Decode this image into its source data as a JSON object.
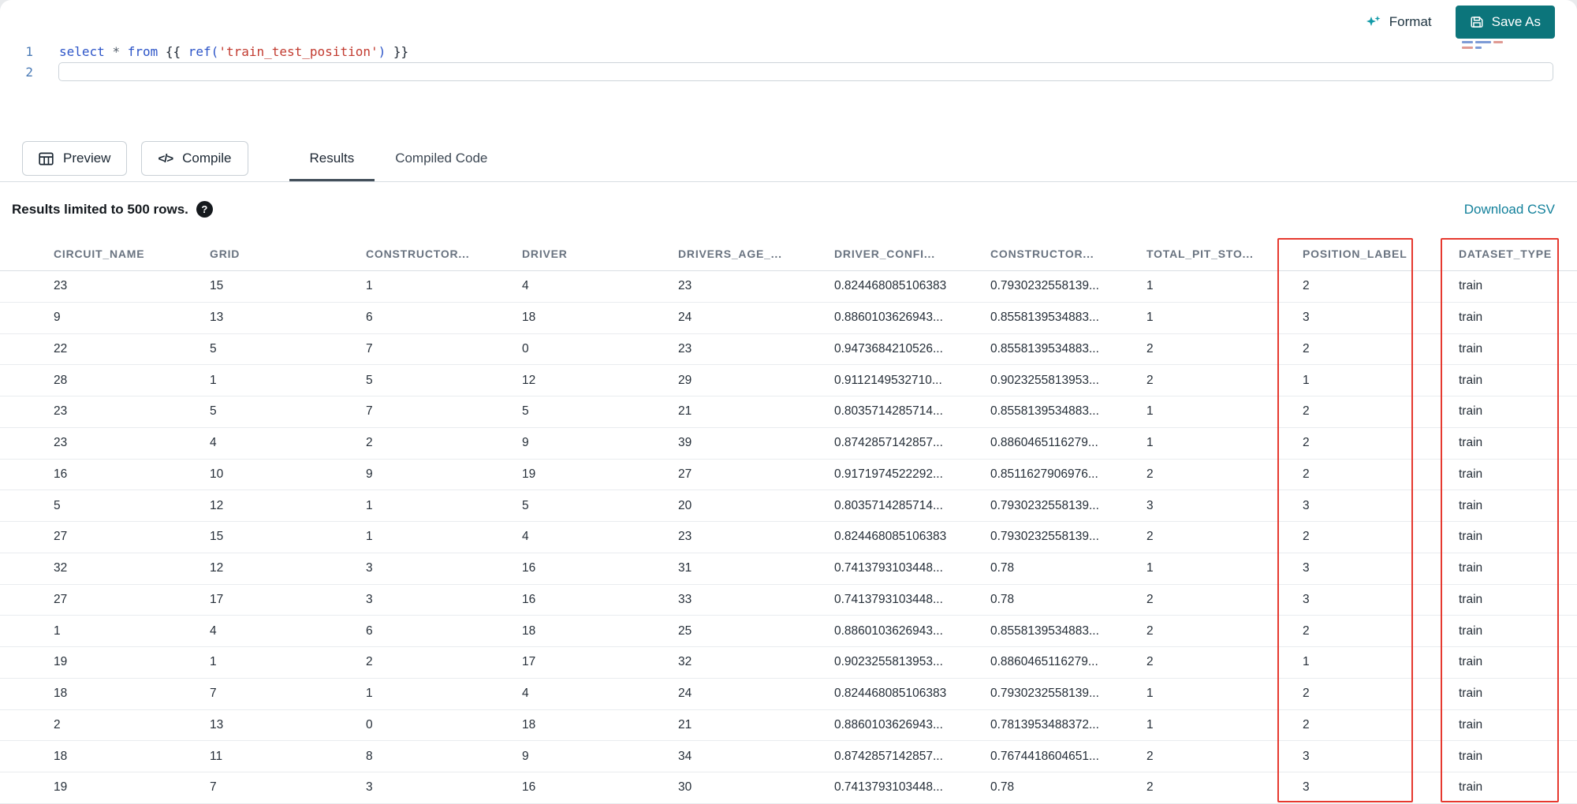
{
  "editor": {
    "format_label": "Format",
    "save_as_label": "Save As",
    "lines": [
      {
        "number": "1",
        "tokens": [
          {
            "text": "select",
            "type": "keyword"
          },
          {
            "text": " ",
            "type": "plain"
          },
          {
            "text": "*",
            "type": "operator"
          },
          {
            "text": " ",
            "type": "plain"
          },
          {
            "text": "from",
            "type": "keyword"
          },
          {
            "text": " {{ ",
            "type": "plain"
          },
          {
            "text": "ref(",
            "type": "function"
          },
          {
            "text": "'train_test_position'",
            "type": "string"
          },
          {
            "text": ")",
            "type": "function"
          },
          {
            "text": " }}",
            "type": "plain"
          }
        ]
      },
      {
        "number": "2",
        "tokens": []
      }
    ],
    "token_colors": {
      "keyword": "#2d55c8",
      "plain": "#1d2733",
      "operator": "#55606c",
      "function": "#2d55c8",
      "string": "#c23b30"
    }
  },
  "toolbar": {
    "preview_label": "Preview",
    "compile_label": "Compile",
    "tabs": [
      {
        "label": "Results",
        "active": true
      },
      {
        "label": "Compiled Code",
        "active": false
      }
    ]
  },
  "results": {
    "limit_text": "Results limited to 500 rows.",
    "help_glyph": "?",
    "download_csv_label": "Download CSV"
  },
  "table": {
    "columns": [
      "CIRCUIT_NAME",
      "GRID",
      "CONSTRUCTOR...",
      "DRIVER",
      "DRIVERS_AGE_...",
      "DRIVER_CONFI...",
      "CONSTRUCTOR...",
      "TOTAL_PIT_STO...",
      "POSITION_LABEL",
      "DATASET_TYPE"
    ],
    "rows": [
      [
        "23",
        "15",
        "1",
        "4",
        "23",
        "0.824468085106383",
        "0.7930232558139...",
        "1",
        "2",
        "train"
      ],
      [
        "9",
        "13",
        "6",
        "18",
        "24",
        "0.8860103626943...",
        "0.8558139534883...",
        "1",
        "3",
        "train"
      ],
      [
        "22",
        "5",
        "7",
        "0",
        "23",
        "0.9473684210526...",
        "0.8558139534883...",
        "2",
        "2",
        "train"
      ],
      [
        "28",
        "1",
        "5",
        "12",
        "29",
        "0.9112149532710...",
        "0.9023255813953...",
        "2",
        "1",
        "train"
      ],
      [
        "23",
        "5",
        "7",
        "5",
        "21",
        "0.8035714285714...",
        "0.8558139534883...",
        "1",
        "2",
        "train"
      ],
      [
        "23",
        "4",
        "2",
        "9",
        "39",
        "0.8742857142857...",
        "0.8860465116279...",
        "1",
        "2",
        "train"
      ],
      [
        "16",
        "10",
        "9",
        "19",
        "27",
        "0.9171974522292...",
        "0.8511627906976...",
        "2",
        "2",
        "train"
      ],
      [
        "5",
        "12",
        "1",
        "5",
        "20",
        "0.8035714285714...",
        "0.7930232558139...",
        "3",
        "3",
        "train"
      ],
      [
        "27",
        "15",
        "1",
        "4",
        "23",
        "0.824468085106383",
        "0.7930232558139...",
        "2",
        "2",
        "train"
      ],
      [
        "32",
        "12",
        "3",
        "16",
        "31",
        "0.7413793103448...",
        "0.78",
        "1",
        "3",
        "train"
      ],
      [
        "27",
        "17",
        "3",
        "16",
        "33",
        "0.7413793103448...",
        "0.78",
        "2",
        "3",
        "train"
      ],
      [
        "1",
        "4",
        "6",
        "18",
        "25",
        "0.8860103626943...",
        "0.8558139534883...",
        "2",
        "2",
        "train"
      ],
      [
        "19",
        "1",
        "2",
        "17",
        "32",
        "0.9023255813953...",
        "0.8860465116279...",
        "2",
        "1",
        "train"
      ],
      [
        "18",
        "7",
        "1",
        "4",
        "24",
        "0.824468085106383",
        "0.7930232558139...",
        "1",
        "2",
        "train"
      ],
      [
        "2",
        "13",
        "0",
        "18",
        "21",
        "0.8860103626943...",
        "0.7813953488372...",
        "1",
        "2",
        "train"
      ],
      [
        "18",
        "11",
        "8",
        "9",
        "34",
        "0.8742857142857...",
        "0.7674418604651...",
        "2",
        "3",
        "train"
      ],
      [
        "19",
        "7",
        "3",
        "16",
        "30",
        "0.7413793103448...",
        "0.78",
        "2",
        "3",
        "train"
      ]
    ]
  },
  "annotations": {
    "highlighted_columns": [
      "POSITION_LABEL",
      "DATASET_TYPE"
    ]
  },
  "colors": {
    "accent": "#0c757b",
    "link": "#12809b",
    "annotation": "#e6392f",
    "tab-underline": "#434f5a"
  }
}
